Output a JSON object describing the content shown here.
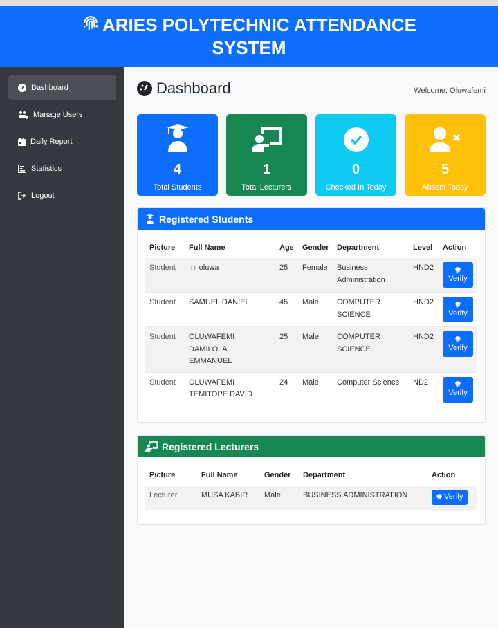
{
  "header": {
    "title_line1": "ARIES POLYTECHNIC ATTENDANCE",
    "title_line2": "SYSTEM"
  },
  "sidebar": {
    "items": [
      {
        "label": "Dashboard",
        "icon": "gauge-icon"
      },
      {
        "label": "Manage Users",
        "icon": "users-cog-icon"
      },
      {
        "label": "Daily Report",
        "icon": "calendar-icon"
      },
      {
        "label": "Statistics",
        "icon": "chart-icon"
      },
      {
        "label": "Logout",
        "icon": "logout-icon"
      }
    ]
  },
  "page": {
    "title": "Dashboard",
    "welcome": "Welcome, Oluwafemi"
  },
  "stats": [
    {
      "value": "4",
      "label": "Total Students",
      "color": "#0d6efd"
    },
    {
      "value": "1",
      "label": "Total Lecturers",
      "color": "#198754"
    },
    {
      "value": "0",
      "label": "Checked In Today",
      "color": "#0dcaf0"
    },
    {
      "value": "5",
      "label": "Absent Today",
      "color": "#ffc107"
    }
  ],
  "students": {
    "title": "Registered Students",
    "headers": [
      "Picture",
      "Full Name",
      "Age",
      "Gender",
      "Department",
      "Level",
      "Action"
    ],
    "rows": [
      {
        "picture": "Student",
        "name": "Ini oluwa",
        "age": "25",
        "gender": "Female",
        "department": "Business Administration",
        "level": "HND2",
        "action": "Verify"
      },
      {
        "picture": "Student",
        "name": "SAMUEL DANIEL",
        "age": "45",
        "gender": "Male",
        "department": "COMPUTER SCIENCE",
        "level": "HND2",
        "action": "Verify"
      },
      {
        "picture": "Student",
        "name": "OLUWAFEMI DAMILOLA EMMANUEL",
        "age": "25",
        "gender": "Male",
        "department": "COMPUTER SCIENCE",
        "level": "HND2",
        "action": "Verify"
      },
      {
        "picture": "Student",
        "name": "OLUWAFEMI TEMITOPE DAVID",
        "age": "24",
        "gender": "Male",
        "department": "Computer Science",
        "level": "ND2",
        "action": "Verify"
      }
    ]
  },
  "lecturers": {
    "title": "Registered Lecturers",
    "headers": [
      "Picture",
      "Full Name",
      "Gender",
      "Department",
      "Action"
    ],
    "rows": [
      {
        "picture": "Lecturer",
        "name": "MUSA KABIR",
        "gender": "Male",
        "department": "BUSINESS ADMINISTRATION",
        "action": "Verify"
      }
    ]
  }
}
